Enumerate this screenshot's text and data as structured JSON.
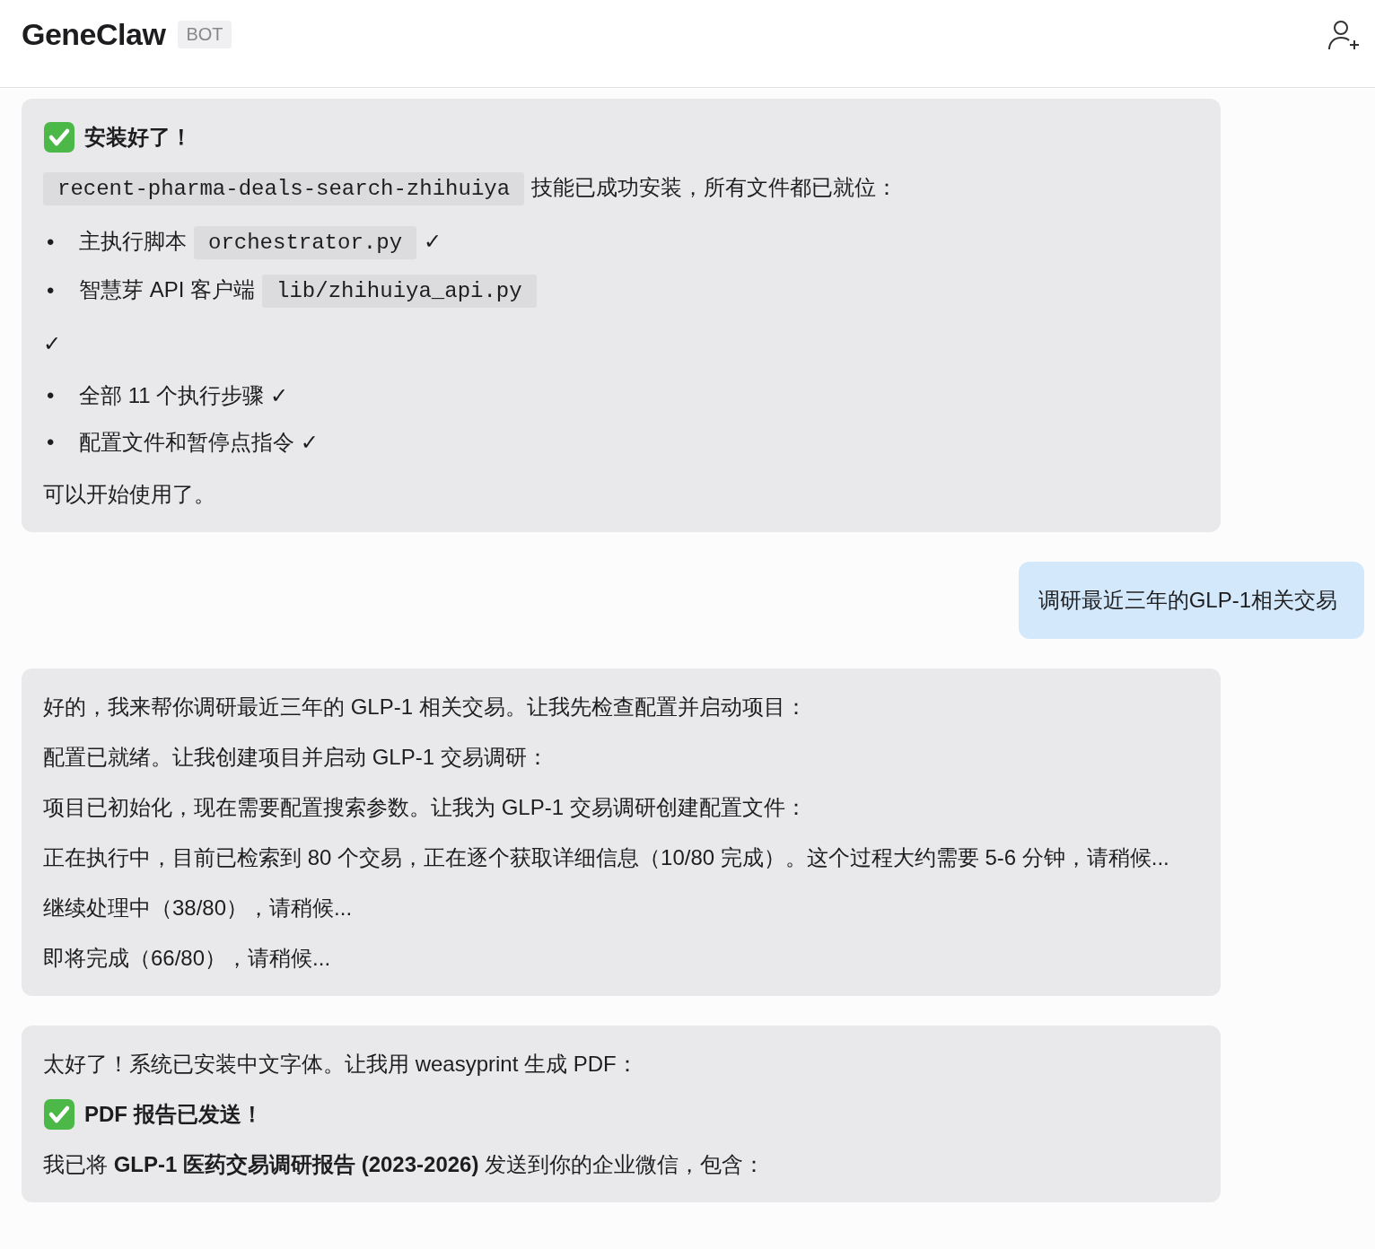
{
  "header": {
    "title": "GeneClaw",
    "badge": "BOT"
  },
  "messages": [
    {
      "kind": "bot",
      "blocks": [
        {
          "kind": "heading",
          "text": "安装好了！"
        },
        {
          "kind": "paragraph",
          "parts": [
            {
              "kind": "code",
              "text": "recent-pharma-deals-search-zhihuiya"
            },
            {
              "kind": "text",
              "text": "技能已成功安装，所有文件都已就位："
            }
          ]
        },
        {
          "kind": "bullets",
          "items": [
            {
              "marker": "•",
              "parts": [
                {
                  "kind": "text",
                  "text": "主执行脚本"
                },
                {
                  "kind": "code",
                  "text": "orchestrator.py"
                },
                {
                  "kind": "text",
                  "text": "✓"
                }
              ]
            },
            {
              "marker": "•",
              "parts": [
                {
                  "kind": "text",
                  "text": "智慧芽 API 客户端"
                },
                {
                  "kind": "code",
                  "text": "lib/zhihuiya_api.py"
                }
              ]
            }
          ]
        },
        {
          "kind": "paragraph",
          "parts": [
            {
              "kind": "text",
              "text": "✓"
            }
          ]
        },
        {
          "kind": "bullets",
          "items": [
            {
              "marker": "•",
              "parts": [
                {
                  "kind": "text",
                  "text": "全部 11 个执行步骤 ✓"
                }
              ]
            },
            {
              "marker": "•",
              "parts": [
                {
                  "kind": "text",
                  "text": "配置文件和暂停点指令 ✓"
                }
              ]
            }
          ]
        },
        {
          "kind": "paragraph",
          "parts": [
            {
              "kind": "text",
              "text": "可以开始使用了。"
            }
          ]
        }
      ]
    },
    {
      "kind": "user",
      "blocks": [
        {
          "kind": "paragraph",
          "parts": [
            {
              "kind": "text",
              "text": "调研最近三年的GLP-1相关交易"
            }
          ]
        }
      ]
    },
    {
      "kind": "bot",
      "blocks": [
        {
          "kind": "paragraph",
          "parts": [
            {
              "kind": "text",
              "text": "好的，我来帮你调研最近三年的 GLP-1 相关交易。让我先检查配置并启动项目："
            }
          ]
        },
        {
          "kind": "paragraph",
          "parts": [
            {
              "kind": "text",
              "text": "配置已就绪。让我创建项目并启动 GLP-1 交易调研："
            }
          ]
        },
        {
          "kind": "paragraph",
          "parts": [
            {
              "kind": "text",
              "text": "项目已初始化，现在需要配置搜索参数。让我为 GLP-1 交易调研创建配置文件："
            }
          ]
        },
        {
          "kind": "paragraph",
          "parts": [
            {
              "kind": "text",
              "text": "正在执行中，目前已检索到 80 个交易，正在逐个获取详细信息（10/80 完成）。这个过程大约需要 5-6 分钟，请稍候..."
            }
          ]
        },
        {
          "kind": "paragraph",
          "parts": [
            {
              "kind": "text",
              "text": "继续处理中（38/80），请稍候..."
            }
          ]
        },
        {
          "kind": "paragraph",
          "parts": [
            {
              "kind": "text",
              "text": "即将完成（66/80），请稍候..."
            }
          ]
        }
      ]
    },
    {
      "kind": "bot",
      "blocks": [
        {
          "kind": "paragraph",
          "parts": [
            {
              "kind": "text",
              "text": "太好了！系统已安装中文字体。让我用 weasyprint 生成 PDF："
            }
          ]
        },
        {
          "kind": "heading",
          "text": "PDF 报告已发送！"
        },
        {
          "kind": "paragraph",
          "parts": [
            {
              "kind": "text",
              "text": "我已将 **GLP-1 医药交易调研报告 (2023-2026)** 发送到你的企业微信，包含："
            }
          ]
        }
      ]
    }
  ]
}
